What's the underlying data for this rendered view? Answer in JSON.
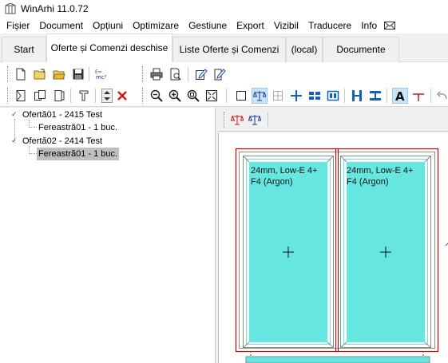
{
  "window": {
    "title": "WinArhi 11.0.72"
  },
  "menu": {
    "items": [
      "Fișier",
      "Document",
      "Opțiuni",
      "Optimizare",
      "Gestiune",
      "Export",
      "Vizibil",
      "Traducere",
      "Info"
    ]
  },
  "tabs": [
    "Start",
    "Oferte și Comenzi deschise",
    "Liste Oferte și Comenzi",
    "(local)",
    "Documente"
  ],
  "active_tab": "Oferte și Comenzi deschise",
  "tree": {
    "nodes": [
      {
        "label": "Ofertă01 - 2415 Test",
        "expanded": true
      },
      {
        "label": "Fereastră01 - 1 buc.",
        "selected": false
      },
      {
        "label": "Ofertă02 - 2414 Test",
        "expanded": true
      },
      {
        "label": "Fereastră01 - 1 buc.",
        "selected": true
      }
    ]
  },
  "drawing": {
    "glass_left": {
      "line1": "24mm, Low-E 4+",
      "line2": "F4 (Argon)"
    },
    "glass_right": {
      "line1": "24mm, Low-E 4+",
      "line2": "F4 (Argon)"
    },
    "colors": {
      "glass": "#66e6e0",
      "frame": "#c00000",
      "profile": "#6a6a6a"
    }
  },
  "icons": {
    "toolbar_row1": [
      "new-document-icon",
      "open-icon",
      "open-folder-icon",
      "save-icon",
      "calculate-icon",
      "print-icon",
      "print-preview-icon",
      "edit-icon",
      "edit-doc-icon"
    ],
    "toolbar_row2": [
      "door-icon",
      "copy-window-icon",
      "paste-window-icon",
      "profile-icon",
      "up-down-icon",
      "delete-icon",
      "zoom-out-icon",
      "zoom-in-icon",
      "zoom-selection-icon",
      "zoom-fit-icon",
      "rectangle-icon",
      "balance-icon",
      "balance-disabled-icon",
      "cross-icon",
      "split-icon",
      "frame-icon",
      "mullion-icon",
      "transom-icon",
      "text-icon",
      "dimension-icon",
      "undo-icon"
    ]
  }
}
